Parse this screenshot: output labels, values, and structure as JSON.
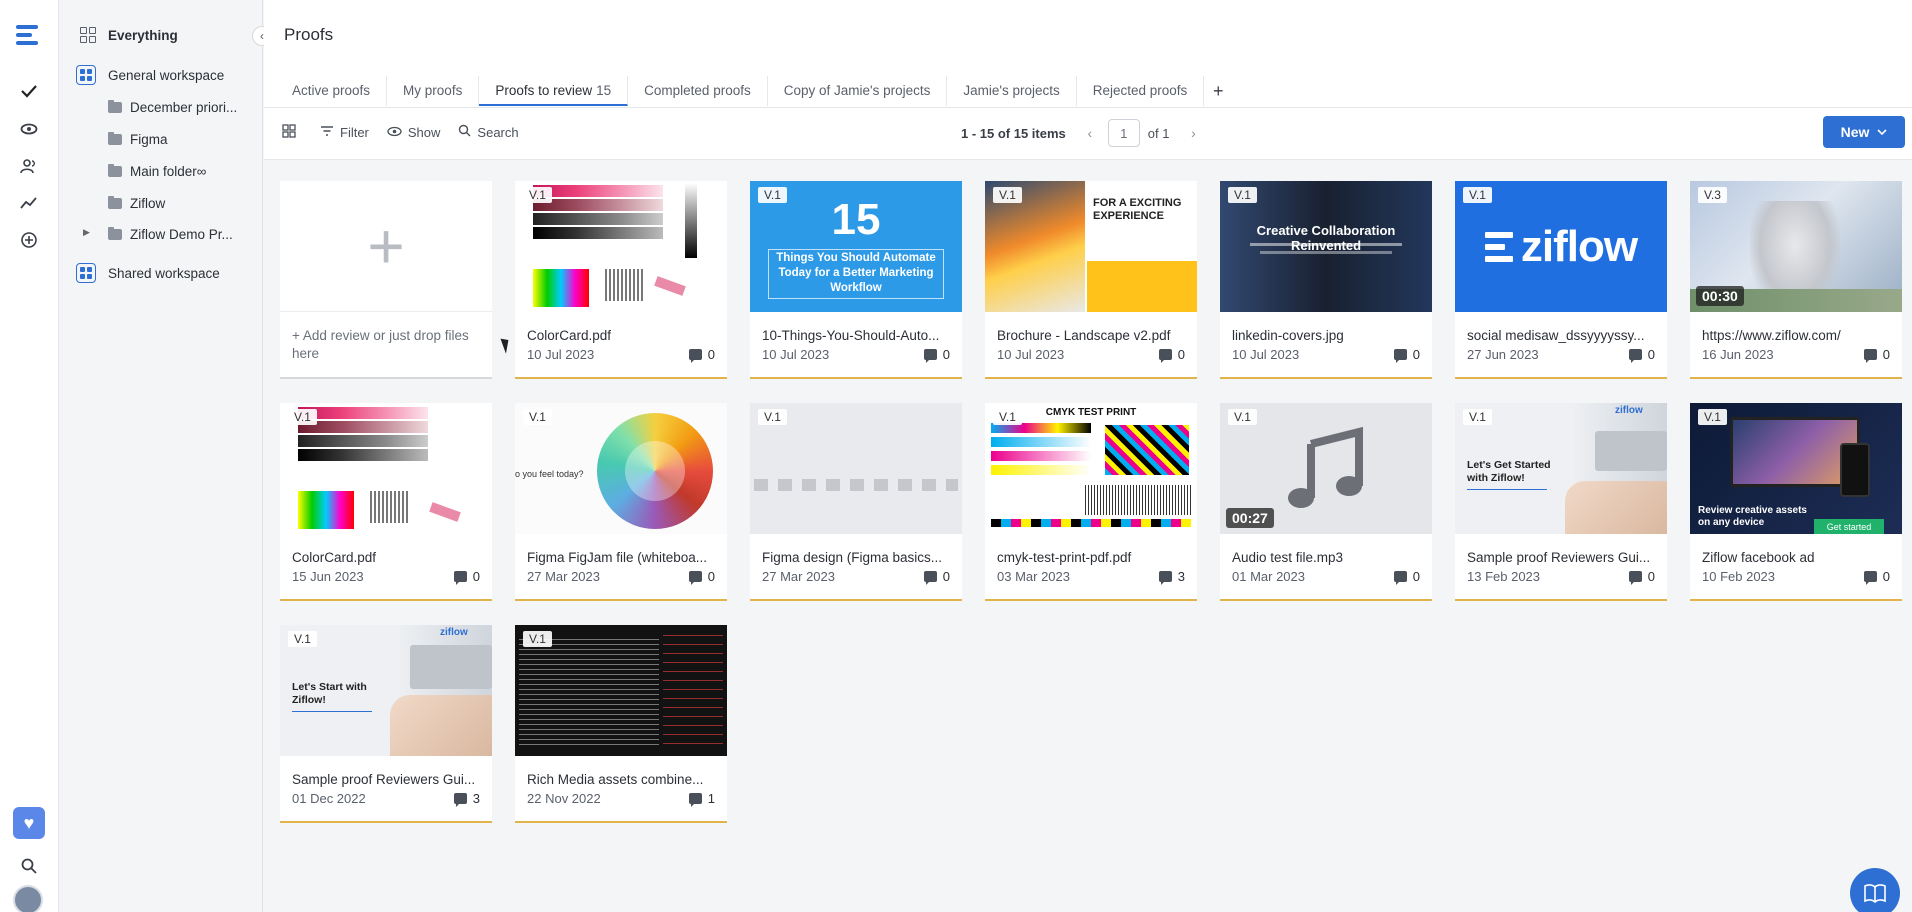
{
  "rail": {
    "icons": [
      "ziflow-logo-icon",
      "check-icon",
      "eye-icon",
      "users-icon",
      "activity-icon",
      "plus-circle-icon",
      "heart-icon",
      "search-icon"
    ]
  },
  "sidebar": {
    "everything": "Everything",
    "general_workspace": "General workspace",
    "folders": [
      {
        "label": "December priori..."
      },
      {
        "label": "Figma"
      },
      {
        "label": "Main folder∞"
      },
      {
        "label": "Ziflow"
      },
      {
        "label": "Ziflow Demo Pr..."
      }
    ],
    "shared_workspace": "Shared workspace"
  },
  "header": {
    "title": "Proofs"
  },
  "tabs": [
    {
      "label": "Active proofs",
      "count": ""
    },
    {
      "label": "My proofs",
      "count": ""
    },
    {
      "label": "Proofs to review",
      "count": "15"
    },
    {
      "label": "Completed proofs",
      "count": ""
    },
    {
      "label": "Copy of Jamie's projects",
      "count": ""
    },
    {
      "label": "Jamie's projects",
      "count": ""
    },
    {
      "label": "Rejected proofs",
      "count": ""
    }
  ],
  "toolbar": {
    "filter": "Filter",
    "show": "Show",
    "search": "Search"
  },
  "pager": {
    "items": "1 - 15 of 15 items",
    "page": "1",
    "of": "of 1"
  },
  "new_button": "New",
  "add_card": {
    "text": "+ Add review or just drop files here"
  },
  "cards": [
    {
      "name": "ColorCard.pdf",
      "date": "10 Jul 2023",
      "comments": "0",
      "version": "V.1"
    },
    {
      "name": "10-Things-You-Should-Auto...",
      "date": "10 Jul 2023",
      "comments": "0",
      "version": "V.1",
      "thumb_big": "15",
      "thumb_text": "Things You Should Automate Today for a Better Marketing Workflow"
    },
    {
      "name": "Brochure - Landscape v2.pdf",
      "date": "10 Jul 2023",
      "comments": "0",
      "version": "V.1",
      "thumb_text": "FOR A EXCITING EXPERIENCE"
    },
    {
      "name": "linkedin-covers.jpg",
      "date": "10 Jul 2023",
      "comments": "0",
      "version": "V.1",
      "thumb_text": "Creative Collaboration Reinvented"
    },
    {
      "name": "social medisaw_dssyyyyssy...",
      "date": "27 Jun 2023",
      "comments": "0",
      "version": "V.1",
      "thumb_text": "ziflow"
    },
    {
      "name": "https://www.ziflow.com/",
      "date": "16 Jun 2023",
      "comments": "0",
      "version": "V.3",
      "duration": "00:30"
    },
    {
      "name": "ColorCard.pdf",
      "date": "15 Jun 2023",
      "comments": "0",
      "version": "V.1"
    },
    {
      "name": "Figma FigJam file (whiteboa...",
      "date": "27 Mar 2023",
      "comments": "0",
      "version": "V.1",
      "thumb_text": "o you feel today?"
    },
    {
      "name": "Figma design (Figma basics...",
      "date": "27 Mar 2023",
      "comments": "0",
      "version": "V.1"
    },
    {
      "name": "cmyk-test-print-pdf.pdf",
      "date": "03 Mar 2023",
      "comments": "3",
      "version": "V.1",
      "thumb_text": "CMYK TEST PRINT"
    },
    {
      "name": "Audio test file.mp3",
      "date": "01 Mar 2023",
      "comments": "0",
      "version": "V.1",
      "duration": "00:27"
    },
    {
      "name": "Sample proof Reviewers Gui...",
      "date": "13 Feb 2023",
      "comments": "0",
      "version": "V.1",
      "thumb_text": "Let's Get Started with Ziflow!",
      "logo_text": "ziflow"
    },
    {
      "name": "Ziflow facebook ad",
      "date": "10 Feb 2023",
      "comments": "0",
      "version": "V.1",
      "thumb_text": "Review creative assets on any device",
      "thumb_button": "Get started"
    },
    {
      "name": "Sample proof Reviewers Gui...",
      "date": "01 Dec 2022",
      "comments": "3",
      "version": "V.1",
      "thumb_text": "Let's Start with Ziflow!",
      "logo_text": "ziflow"
    },
    {
      "name": "Rich Media assets combine...",
      "date": "22 Nov 2022",
      "comments": "1",
      "version": "V.1"
    }
  ],
  "colors": {
    "accent": "#2d6fd2",
    "card_underline": "#e0b44a"
  }
}
